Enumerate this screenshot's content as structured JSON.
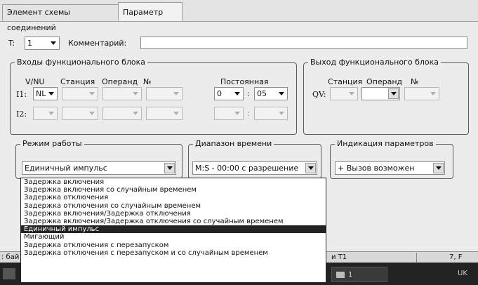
{
  "tabs": [
    "Элемент схемы соединений",
    "Параметр"
  ],
  "top_row": {
    "t_label": "T:",
    "t_value": "1",
    "comment_label": "Комментарий:",
    "comment_value": ""
  },
  "inputs_group": {
    "title": "Входы функционального блока",
    "col_vnu": "V/NU",
    "col_station": "Станция",
    "col_operand": "Операнд",
    "col_no": "№",
    "col_const": "Постоянная",
    "i1_label": "I1:",
    "i1_vnu": "NL",
    "i1_const_a": "0",
    "i1_colon": ":",
    "i1_const_b": "05",
    "i2_label": "I2:",
    "i2_colon": ":"
  },
  "outputs_group": {
    "title": "Выход функционального блока",
    "col_station": "Станция",
    "col_operand": "Операнд",
    "col_no": "№",
    "qv_label": "QV:"
  },
  "mode_group": {
    "title": "Режим работы",
    "value": "Единичный импульс"
  },
  "range_group": {
    "title": "Диапазон времени",
    "value": "M:S - 00:00 с разрешение"
  },
  "indication_group": {
    "title": "Индикация параметров",
    "value": "+ Вызов возможен"
  },
  "dropdown": {
    "selected_index": 6,
    "items": [
      "Задержка включения",
      "Задержка включения со случайным временем",
      "Задержка отключения",
      "Задержка отключения со случайным временем",
      "Задержка включения/Задержка отключения",
      "Задержка включения/Задержка отключения со случайным временем",
      "Единичный импульс",
      "Мигающий",
      "Задержка отключения с перезапуском",
      "Задержка отключения с перезапуском и со случайным временем"
    ]
  },
  "statusbar": {
    "left": ": бай",
    "middle": "и T1",
    "right": "7, F"
  },
  "taskbar": {
    "task_label": "1",
    "lang": "UK"
  }
}
